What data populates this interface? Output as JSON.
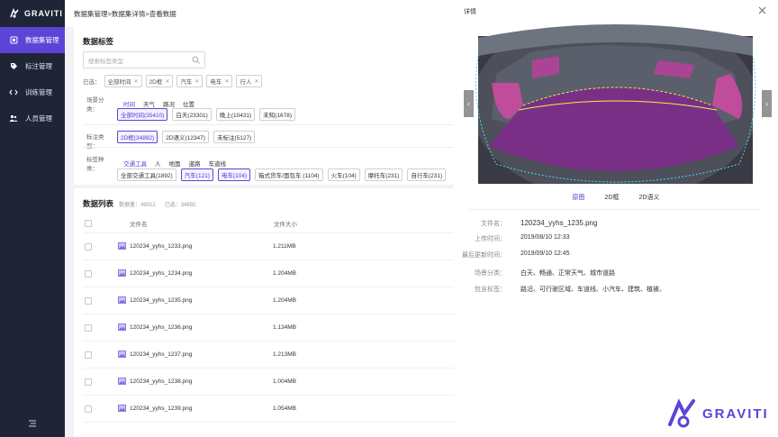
{
  "brand": {
    "name": "GRAVITI",
    "accent": "#5b45d6"
  },
  "sidebar": {
    "items": [
      {
        "label": "数据集管理",
        "icon": "database-icon",
        "active": true
      },
      {
        "label": "标注管理",
        "icon": "tag-icon",
        "active": false
      },
      {
        "label": "训练管理",
        "icon": "code-icon",
        "active": false
      },
      {
        "label": "人员管理",
        "icon": "users-icon",
        "active": false
      }
    ]
  },
  "breadcrumb": "数据集管理>数据集详情>查看数据",
  "tags_panel": {
    "title": "数据标签",
    "search_placeholder": "搜索标签类型",
    "selected_label": "已选：",
    "selected": [
      "全部时间",
      "2D框",
      "汽车",
      "电车",
      "行人"
    ],
    "scene": {
      "label": "场景分类：",
      "options": [
        "时间",
        "天气",
        "路况",
        "位置"
      ],
      "values": [
        "全部时间(35410)",
        "白天(23301)",
        "晚上(10431)",
        "未知(1678)"
      ]
    },
    "annotation": {
      "label": "标注类型：",
      "values": [
        "2D框(34892)",
        "2D语义(12347)",
        "未标注(5127)"
      ]
    },
    "category": {
      "label": "标签种类：",
      "options": [
        "交通工具",
        "人",
        "地面",
        "道路",
        "车道线"
      ],
      "values": [
        "全部交通工具(1892)",
        "汽车(121)",
        "电车(104)",
        "箱式货车/面包车 (1104)",
        "火车(104)",
        "摩托车(231)",
        "自行车(231)"
      ]
    }
  },
  "list": {
    "title": "数据列表",
    "count_label": "数据量：49012",
    "selected_label": "已选：34892",
    "col_name": "文件名",
    "col_size": "文件大小",
    "rows": [
      {
        "name": "120234_yyhs_1233.png",
        "size": "1.211MB"
      },
      {
        "name": "120234_yyhs_1234.png",
        "size": "1.204MB"
      },
      {
        "name": "120234_yyhs_1235.png",
        "size": "1.204MB"
      },
      {
        "name": "120234_yyhs_1236.png",
        "size": "1.134MB"
      },
      {
        "name": "120234_yyhs_1237.png",
        "size": "1.213MB"
      },
      {
        "name": "120234_yyhs_1238.png",
        "size": "1.004MB"
      },
      {
        "name": "120234_yyhs_1239.png",
        "size": "1.054MB"
      }
    ]
  },
  "drawer": {
    "title": "详情",
    "tabs": [
      "原图",
      "2D框",
      "2D语义"
    ],
    "fields": [
      {
        "key": "文件名：",
        "value": "120234_yyhs_1235.png"
      },
      {
        "key": "上传时间：",
        "value": "2019/08/10 12:33"
      },
      {
        "key": "最后更新时间：",
        "value": "2019/09/10 12:45"
      },
      {
        "key": "场景分类：",
        "value": "白天、畅通、正常天气、城市道路"
      },
      {
        "key": "包含标签：",
        "value": "路沿、可行驶区域、车道线、小汽车、建筑、植被、"
      }
    ]
  }
}
